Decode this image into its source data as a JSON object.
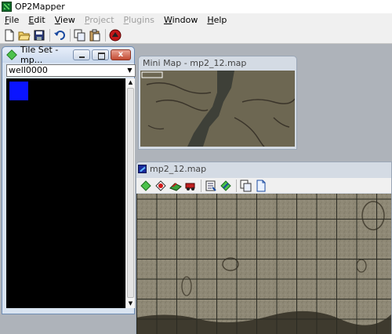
{
  "app": {
    "title": "OP2Mapper"
  },
  "menu": [
    {
      "label": "File",
      "enabled": true
    },
    {
      "label": "Edit",
      "enabled": true
    },
    {
      "label": "View",
      "enabled": true
    },
    {
      "label": "Project",
      "enabled": false
    },
    {
      "label": "Plugins",
      "enabled": false
    },
    {
      "label": "Window",
      "enabled": true
    },
    {
      "label": "Help",
      "enabled": true
    }
  ],
  "toolbar": {
    "buttons": [
      "new-file-icon",
      "open-folder-icon",
      "save-icon",
      "undo-icon",
      "copy-icon",
      "paste-icon",
      "about-icon"
    ]
  },
  "tileset_window": {
    "title": "Tile Set - mp...",
    "combo_value": "well0000",
    "close_label": "x",
    "selected_tile_color": "#0a14ff"
  },
  "minimap_window": {
    "title": "Mini Map - mp2_12.map"
  },
  "map_window": {
    "title": "mp2_12.map",
    "toolbar_buttons": [
      "terrain-tool-icon",
      "unit-tool-icon",
      "wall-tool-icon",
      "vehicle-tool-icon",
      "properties-icon",
      "fill-icon",
      "copy-region-icon",
      "page-icon"
    ]
  },
  "colors": {
    "mdi_background": "#aeb3ba",
    "terrain": "#8e8876",
    "grid_line": "#2a2a22"
  }
}
